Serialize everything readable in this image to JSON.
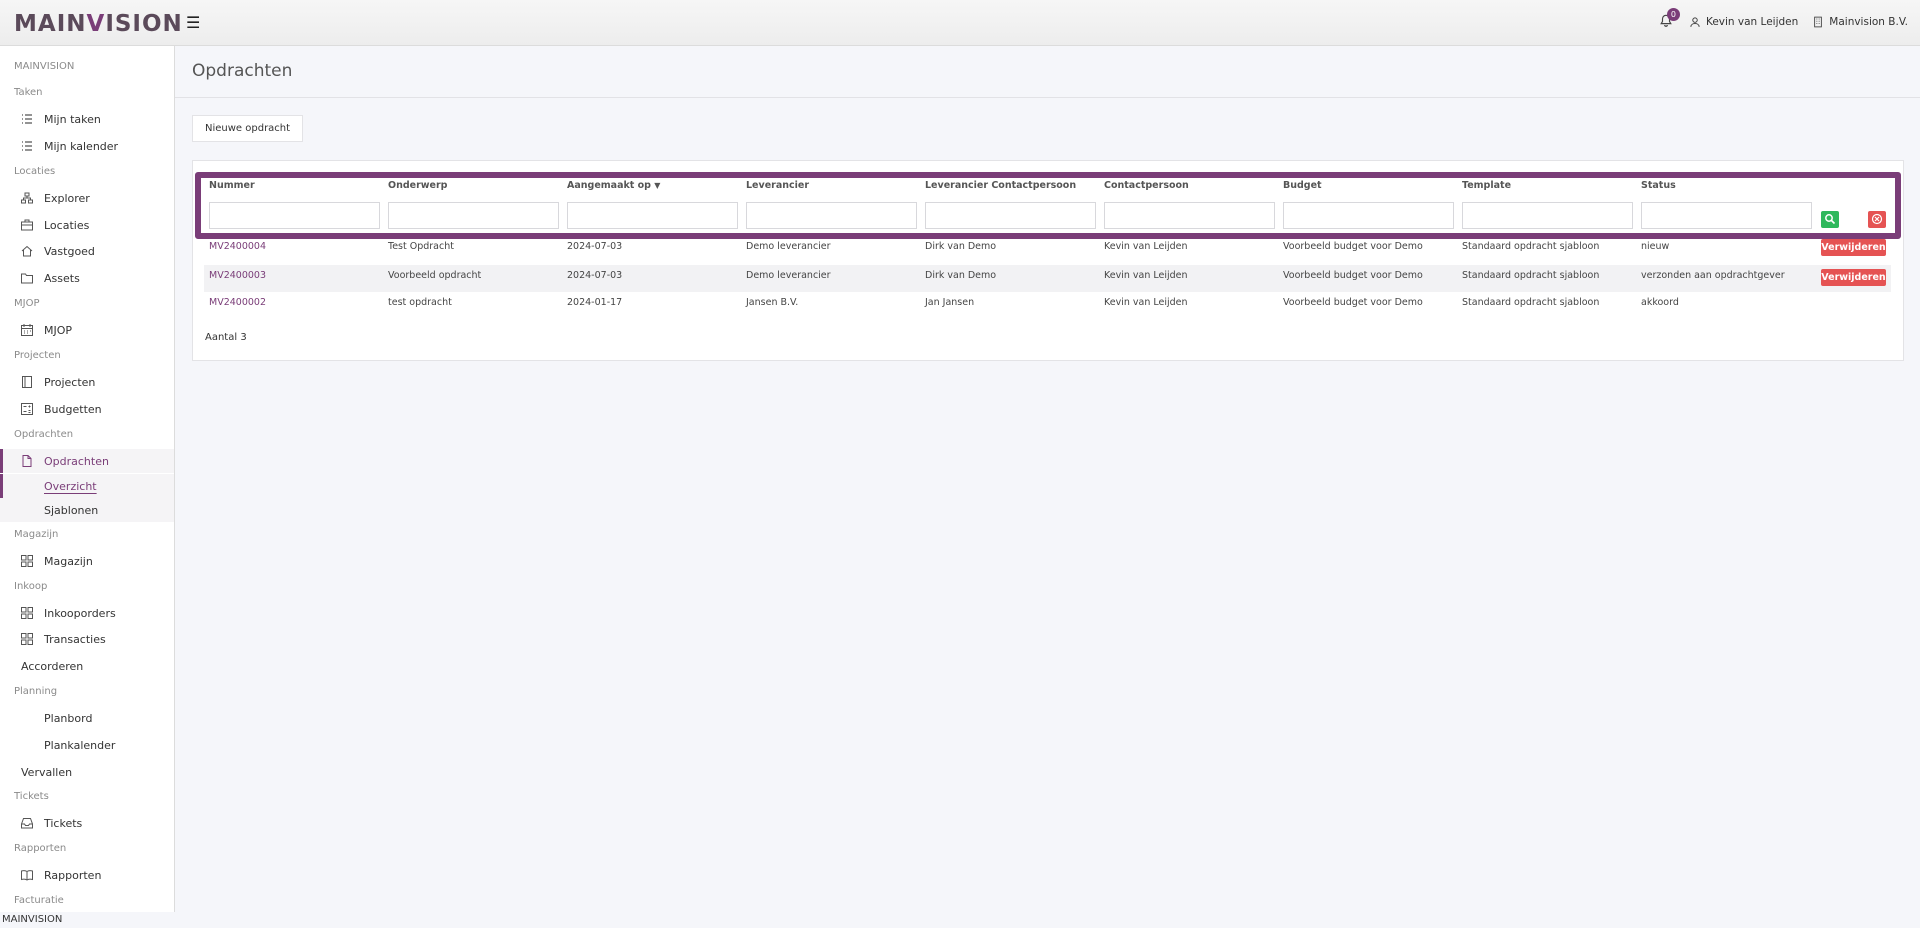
{
  "brand": {
    "logo_pre": "MAIN",
    "logo_v": "V",
    "logo_post": "ISION"
  },
  "topbar": {
    "menu_icon": "hamburger-icon",
    "notifications_count": "0",
    "user_name": "Kevin van Leijden",
    "company": "Mainvision B.V."
  },
  "sidebar": {
    "brand_label": "MAINVISION",
    "sections": {
      "taken": "Taken",
      "locaties": "Locaties",
      "mjop": "MJOP",
      "projecten": "Projecten",
      "opdrachten": "Opdrachten",
      "magazijn": "Magazijn",
      "inkoop": "Inkoop",
      "planning": "Planning",
      "tickets": "Tickets",
      "rapporten": "Rapporten",
      "facturatie": "Facturatie"
    },
    "items": {
      "mijn_taken": "Mijn taken",
      "mijn_kalender": "Mijn kalender",
      "explorer": "Explorer",
      "locaties": "Locaties",
      "vastgoed": "Vastgoed",
      "assets": "Assets",
      "mjop": "MJOP",
      "projecten": "Projecten",
      "budgetten": "Budgetten",
      "opdrachten": "Opdrachten",
      "overzicht": "Overzicht",
      "sjablonen": "Sjablonen",
      "magazijn": "Magazijn",
      "inkooporders": "Inkooporders",
      "transacties": "Transacties",
      "accorderen": "Accorderen",
      "planbord": "Planbord",
      "plankalender": "Plankalender",
      "vervallen": "Vervallen",
      "tickets": "Tickets",
      "rapporten": "Rapporten"
    }
  },
  "page": {
    "title": "Opdrachten",
    "new_button": "Nieuwe opdracht",
    "columns": {
      "nummer": "Nummer",
      "onderwerp": "Onderwerp",
      "aangemaakt_op": "Aangemaakt op",
      "leverancier": "Leverancier",
      "leverancier_contactpersoon": "Leverancier Contactpersoon",
      "contactpersoon": "Contactpersoon",
      "budget": "Budget",
      "template": "Template",
      "status": "Status"
    },
    "sort_indicator": "▼",
    "delete_label": "Verwijderen",
    "rows": [
      {
        "nummer": "MV2400004",
        "onderwerp": "Test Opdracht",
        "aangemaakt_op": "2024-07-03",
        "leverancier": "Demo leverancier",
        "leverancier_contactpersoon": "Dirk van Demo",
        "contactpersoon": "Kevin van Leijden",
        "budget": "Voorbeeld budget voor Demo",
        "template": "Standaard opdracht sjabloon",
        "status": "nieuw"
      },
      {
        "nummer": "MV2400003",
        "onderwerp": "Voorbeeld opdracht",
        "aangemaakt_op": "2024-07-03",
        "leverancier": "Demo leverancier",
        "leverancier_contactpersoon": "Dirk van Demo",
        "contactpersoon": "Kevin van Leijden",
        "budget": "Voorbeeld budget voor Demo",
        "template": "Standaard opdracht sjabloon",
        "status": "verzonden aan opdrachtgever"
      },
      {
        "nummer": "MV2400002",
        "onderwerp": "test opdracht",
        "aangemaakt_op": "2024-01-17",
        "leverancier": "Jansen B.V.",
        "leverancier_contactpersoon": "Jan Jansen",
        "contactpersoon": "Kevin van Leijden",
        "budget": "Voorbeeld budget voor Demo",
        "template": "Standaard opdracht sjabloon",
        "status": "akkoord"
      }
    ],
    "count_label": "Aantal 3"
  },
  "footer": {
    "text": "MAINVISION"
  },
  "colors": {
    "brand": "#7a3d78",
    "success": "#2eb85c",
    "danger": "#e55353"
  }
}
